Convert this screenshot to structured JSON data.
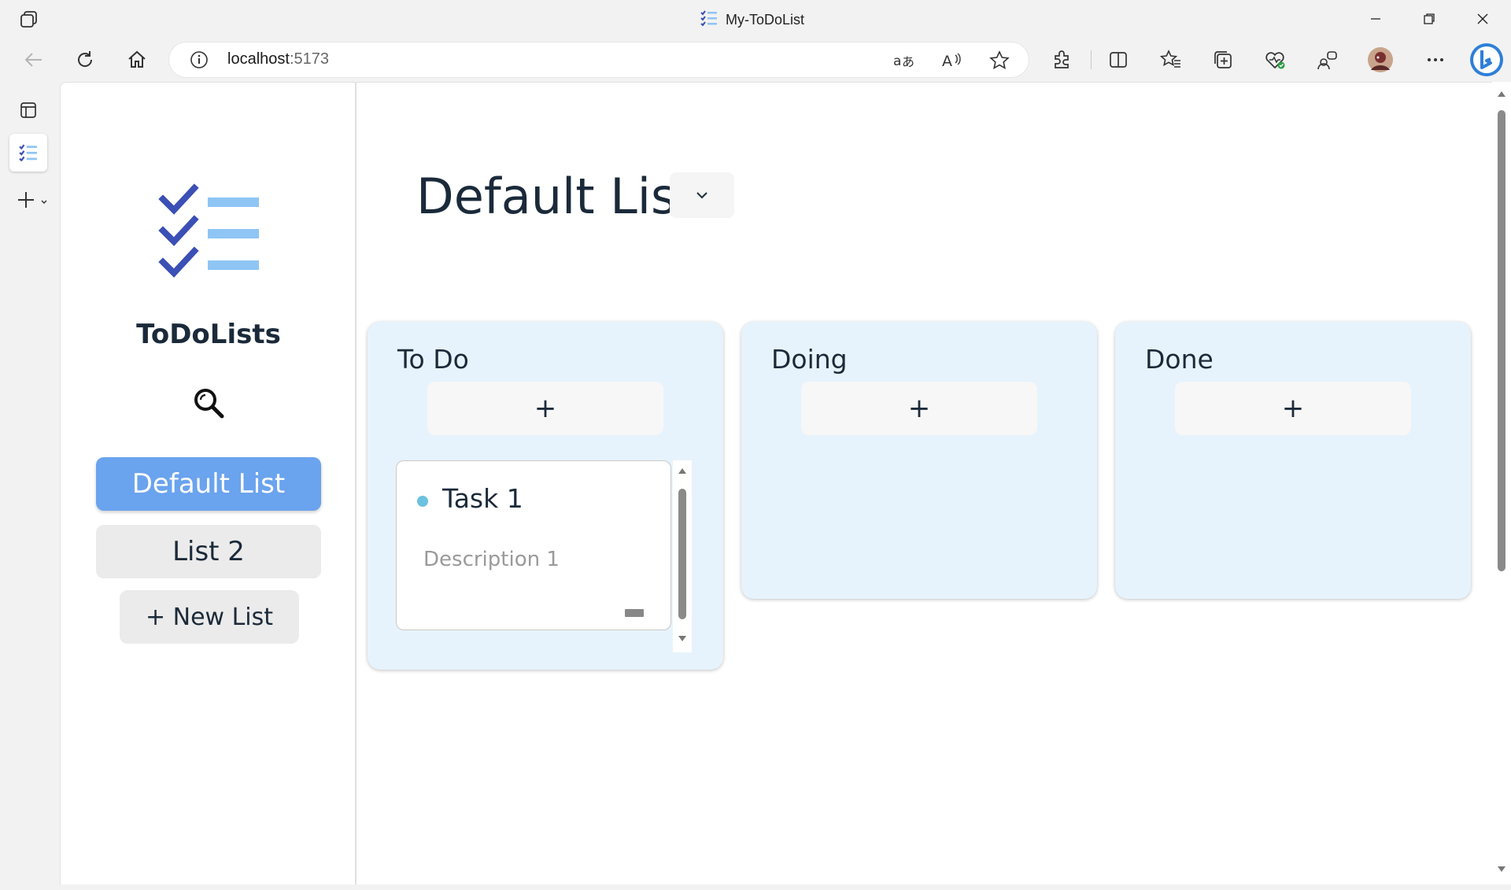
{
  "window": {
    "title": "My-ToDoList"
  },
  "browser": {
    "url_host": "localhost",
    "url_port": ":5173"
  },
  "app": {
    "name": "ToDoLists",
    "lists": [
      "Default List",
      "List 2"
    ],
    "new_list_label": "+ New List",
    "active_list_title": "Default List"
  },
  "board": {
    "columns": [
      {
        "title": "To Do",
        "add_label": "+"
      },
      {
        "title": "Doing",
        "add_label": "+"
      },
      {
        "title": "Done",
        "add_label": "+"
      }
    ],
    "tasks": [
      {
        "column": "To Do",
        "name": "Task 1",
        "description": "Description 1"
      }
    ]
  },
  "colors": {
    "accent": "#6aa3ee",
    "column_bg": "#e7f3fc",
    "task_dot": "#6ac2de",
    "logo_check": "#3b4fb5",
    "logo_line": "#8ec5f5"
  },
  "icons": {
    "logo": "checklist-icon",
    "search": "magnifier-icon",
    "dropdown": "chevron-down-icon"
  }
}
